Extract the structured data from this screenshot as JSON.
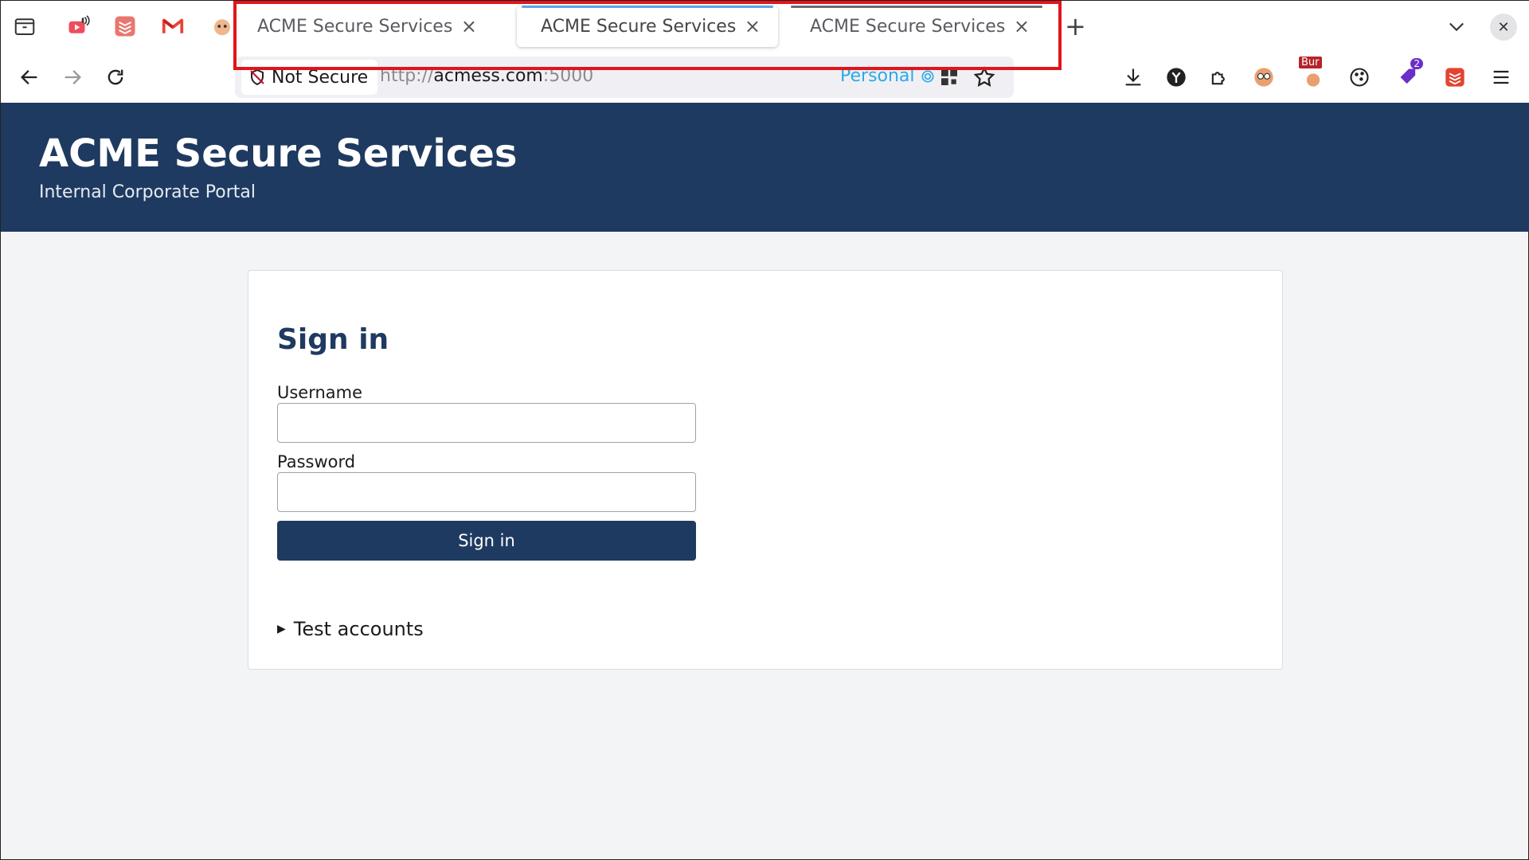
{
  "browser": {
    "tabs": [
      {
        "title": "ACME Secure Services",
        "close": "×"
      },
      {
        "title": "ACME Secure Services",
        "close": "×"
      },
      {
        "title": "ACME Secure Services",
        "close": "×"
      }
    ],
    "new_tab": "+",
    "window_close": "✕",
    "url_bar": {
      "security_label": "Not Secure",
      "url_scheme": "http://",
      "url_host": "acmess.com",
      "url_port": ":5000",
      "container_label": "Personal"
    },
    "extension_badges": {
      "burp_label": "Bur",
      "notification_count": "2"
    },
    "colors": {
      "active_tab_bar": "#5aa7e6",
      "third_tab_bar": "#6b6b70",
      "highlight": "#e0151b"
    }
  },
  "header": {
    "title": "ACME Secure Services",
    "subtitle": "Internal Corporate Portal",
    "background": "#1f3a60"
  },
  "login": {
    "heading": "Sign in",
    "username_label": "Username",
    "username_value": "",
    "password_label": "Password",
    "password_value": "",
    "submit_label": "Sign in",
    "test_accounts_label": "Test accounts",
    "disclosure_marker": "▶"
  }
}
